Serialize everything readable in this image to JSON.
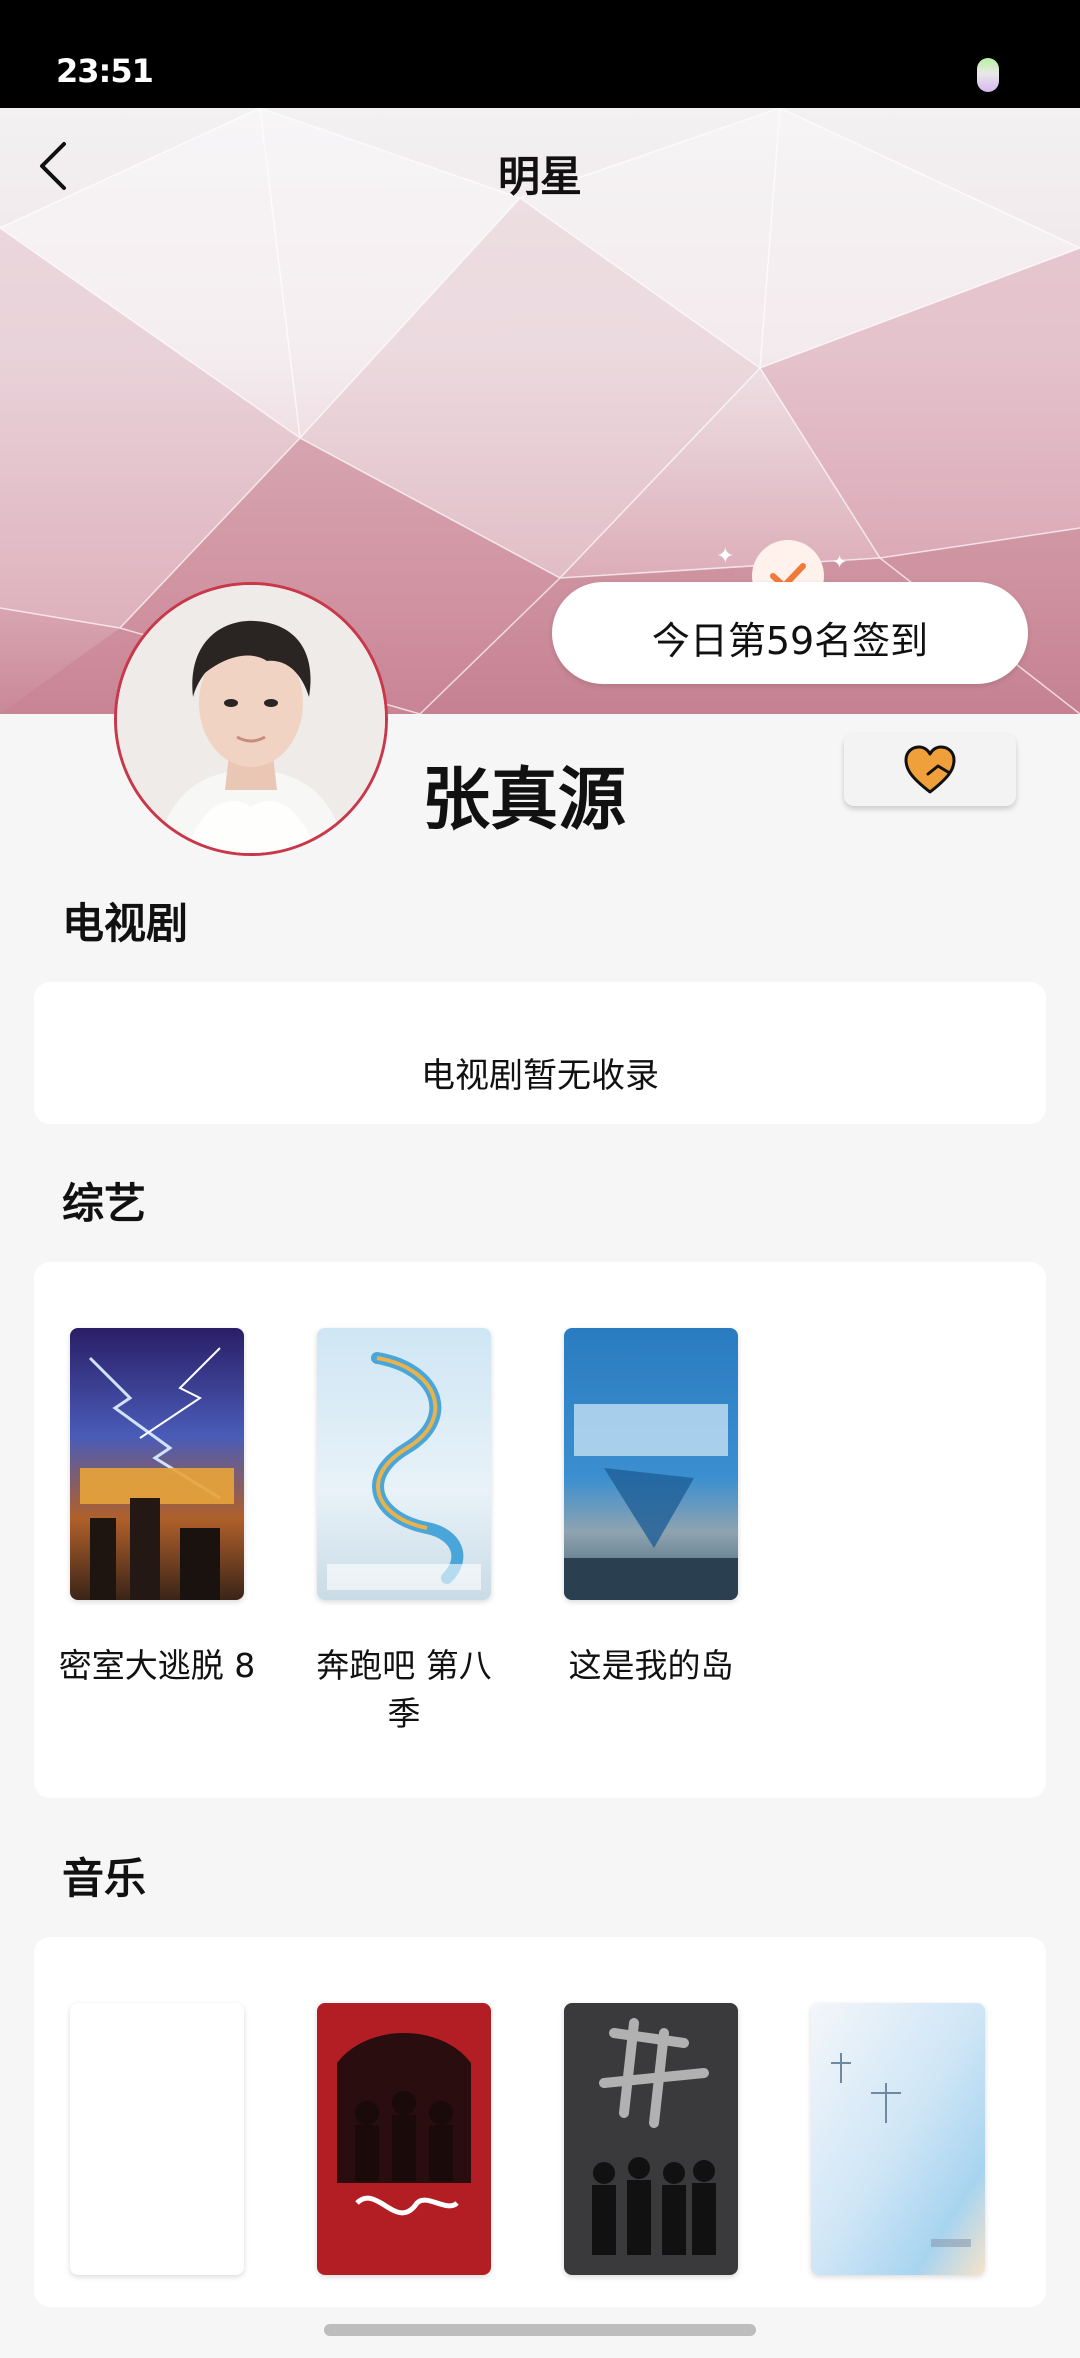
{
  "status_bar": {
    "time": "23:51"
  },
  "header": {
    "title": "明星"
  },
  "checkin": {
    "text": "今日第59名签到"
  },
  "star": {
    "name": "张真源"
  },
  "sections": {
    "tv": {
      "title": "电视剧",
      "empty_text": "电视剧暂无收录"
    },
    "variety": {
      "title": "综艺",
      "items": [
        {
          "title": "密室大逃脱 8"
        },
        {
          "title": "奔跑吧 第八季"
        },
        {
          "title": "这是我的岛"
        }
      ]
    },
    "music": {
      "title": "音乐"
    }
  },
  "colors": {
    "accent": "#f0a03a",
    "avatar_ring": "#c9374a",
    "background": "#f6f6f6"
  },
  "icons": [
    "back-arrow-icon",
    "check-icon",
    "heart-icon"
  ]
}
